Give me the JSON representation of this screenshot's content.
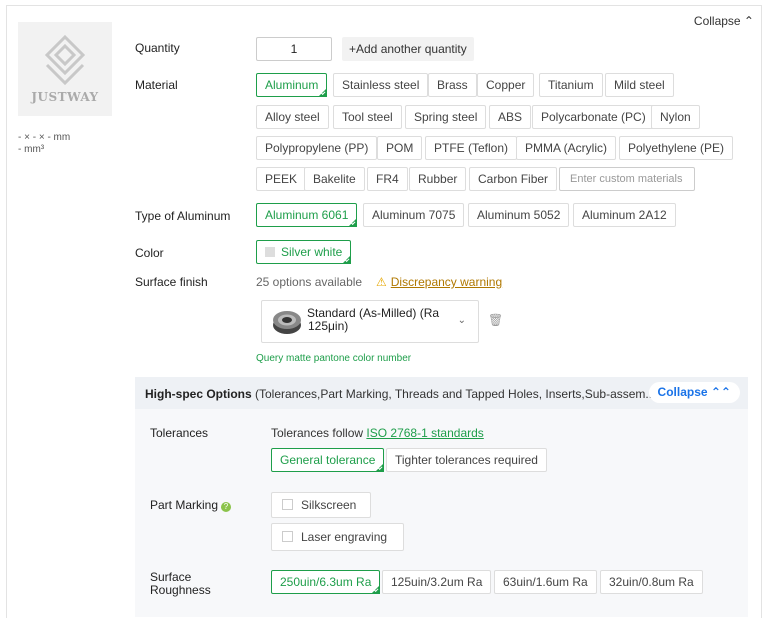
{
  "header": {
    "collapse_label": "Collapse ⌃"
  },
  "thumbnail": {
    "logo_text": "JUSTWAY",
    "dims_line1": "- × - × - mm",
    "dims_line2": "- mm³"
  },
  "quantity": {
    "label": "Quantity",
    "value": "1",
    "add_label": "+Add another quantity"
  },
  "material": {
    "label": "Material",
    "options": [
      "Aluminum",
      "Stainless steel",
      "Brass",
      "Copper",
      "Titanium",
      "Mild steel",
      "Alloy steel",
      "Tool steel",
      "Spring steel",
      "ABS",
      "Polycarbonate (PC)",
      "Nylon",
      "Polypropylene (PP)",
      "POM",
      "PTFE (Teflon)",
      "PMMA (Acrylic)",
      "Polyethylene (PE)",
      "PEEK",
      "Bakelite",
      "FR4",
      "Rubber",
      "Carbon Fiber"
    ],
    "selected": "Aluminum",
    "custom_placeholder": "Enter custom materials"
  },
  "type": {
    "label": "Type of Aluminum",
    "options": [
      "Aluminum 6061",
      "Aluminum 7075",
      "Aluminum 5052",
      "Aluminum 2A12"
    ],
    "selected": "Aluminum 6061"
  },
  "color": {
    "label": "Color",
    "value": "Silver white"
  },
  "surface": {
    "label": "Surface finish",
    "available": "25 options available",
    "warning": "Discrepancy warning",
    "finish_line1": "Standard (As-Milled) (Ra",
    "finish_line2": "125μin)",
    "pantone": "Query matte pantone color number"
  },
  "highspec": {
    "title": "High-spec Options",
    "subtitle": "(Tolerances,Part Marking, Threads and Tapped Holes, Inserts,Sub-assem...)",
    "collapse_label": "Collapse ⌃⌃",
    "tolerances": {
      "label": "Tolerances",
      "text": "Tolerances follow ",
      "link": "ISO 2768-1 standards",
      "options": [
        "General tolerance",
        "Tighter tolerances required"
      ]
    },
    "part_marking": {
      "label": "Part Marking",
      "options": [
        "Silkscreen",
        "Laser engraving"
      ]
    },
    "roughness": {
      "label_line1": "Surface",
      "label_line2": "Roughness",
      "options": [
        "250uin/6.3um Ra",
        "125uin/3.2um Ra",
        "63uin/1.6um Ra",
        "32uin/0.8um Ra"
      ]
    }
  },
  "colors": {
    "accent_green": "#1e9e4a",
    "link_blue": "#1a73e8",
    "warning": "#e6a700"
  }
}
